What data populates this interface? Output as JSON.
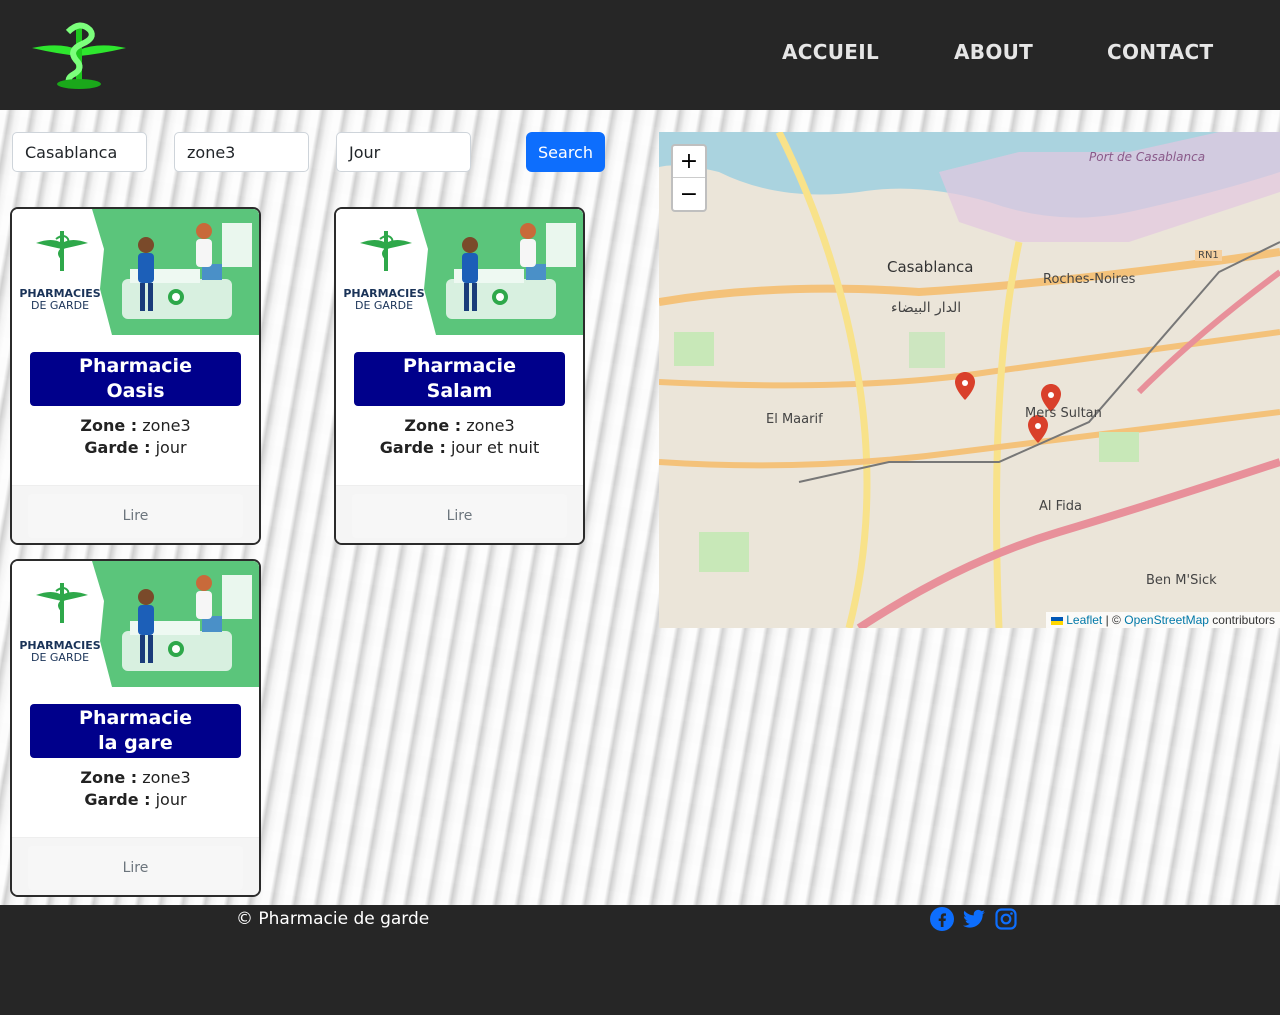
{
  "nav": {
    "items": [
      "ACCUEIL",
      "ABOUT",
      "CONTACT"
    ]
  },
  "search": {
    "city": "Casablanca",
    "zone": "zone3",
    "period": "Jour",
    "button": "Search"
  },
  "cards": [
    {
      "title_line1": "Pharmacie",
      "title_line2": "Oasis",
      "zone_label": "Zone :",
      "zone": "zone3",
      "garde_label": "Garde :",
      "garde": "jour",
      "read": "Lire",
      "badge_top": "PHARMACIES",
      "badge_bottom": "DE GARDE"
    },
    {
      "title_line1": "Pharmacie",
      "title_line2": "Salam",
      "zone_label": "Zone :",
      "zone": "zone3",
      "garde_label": "Garde :",
      "garde": "jour et nuit",
      "read": "Lire",
      "badge_top": "PHARMACIES",
      "badge_bottom": "DE GARDE"
    },
    {
      "title_line1": "Pharmacie",
      "title_line2": "la gare",
      "zone_label": "Zone :",
      "zone": "zone3",
      "garde_label": "Garde :",
      "garde": "jour",
      "read": "Lire",
      "badge_top": "PHARMACIES",
      "badge_bottom": "DE GARDE"
    }
  ],
  "map": {
    "zoom_in": "+",
    "zoom_out": "−",
    "labels": {
      "city": "Casablanca",
      "city_ar": "الدار البيضاء",
      "port": "Port de Casablanca",
      "roches": "Roches-Noires",
      "maarif": "El Maarif",
      "mers": "Mers Sultan",
      "fida": "Al Fida",
      "benmsick": "Ben M'Sick",
      "rn1": "RN1"
    },
    "attribution": {
      "leaflet": "Leaflet",
      "sep": "| ©",
      "osm": "OpenStreetMap",
      "contrib": "contributors"
    }
  },
  "footer": {
    "copyright": "© Pharmacie de garde"
  },
  "colors": {
    "header": "#262626",
    "title_bg": "#00008b",
    "button": "#0d6efd",
    "logo_green": "#22dd22"
  }
}
